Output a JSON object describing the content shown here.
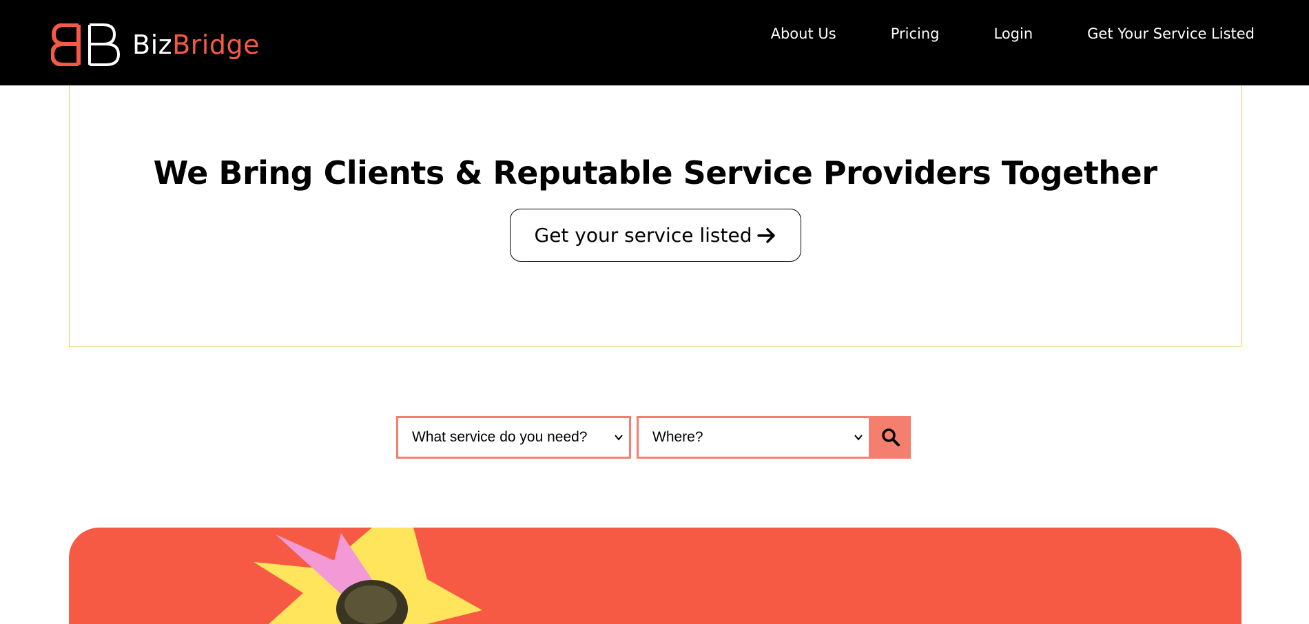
{
  "header": {
    "brand_part1": "Biz",
    "brand_part2": "Bridge",
    "nav": [
      {
        "label": "About Us"
      },
      {
        "label": "Pricing"
      },
      {
        "label": "Login"
      },
      {
        "label": "Get Your Service Listed"
      }
    ]
  },
  "hero": {
    "title": "We Bring Clients & Reputable Service Providers Together",
    "cta_label": "Get your service listed",
    "cta_icon": "arrow-right-icon"
  },
  "search": {
    "service_selected": "What service do you need?",
    "location_selected": "Where?",
    "button_icon": "search-icon"
  },
  "colors": {
    "header_bg": "#000000",
    "brand_accent": "#f65a45",
    "search_accent": "#f57f6f",
    "hero_border": "#f2c66a",
    "banner_bg": "#f65a45"
  }
}
